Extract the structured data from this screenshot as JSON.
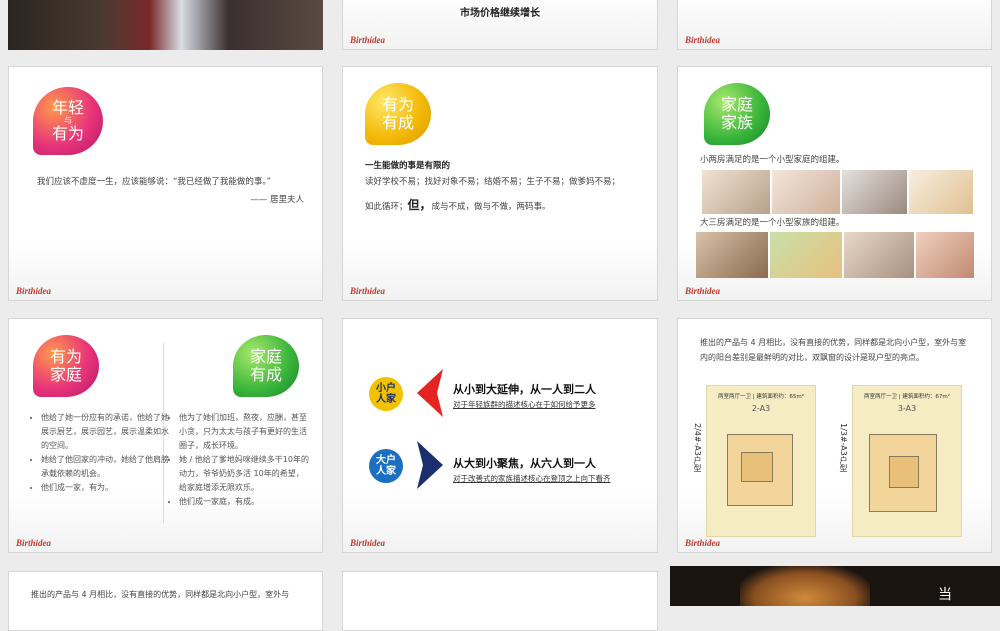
{
  "brand_mark": "Birthidea",
  "slides": {
    "top_center": {
      "heading": "市场价格继续增长"
    },
    "youth": {
      "bubble_line1": "年轻",
      "bubble_line2": "与",
      "bubble_line3": "有为",
      "quote": "我们应该不虚度一生，应该能够说：“我已经做了我能做的事。”",
      "author": "—— 居里夫人"
    },
    "achieve": {
      "bubble_line1": "有为",
      "bubble_line2": "有成",
      "title": "一生能做的事是有限的",
      "line1": "读好学校不易；找好对象不易；结婚不易；生子不易；做爹妈不易；",
      "line2_before": "如此循环；",
      "line2_emph": "但，",
      "line2_after": "成与不成，做与不做，两码事。"
    },
    "family": {
      "bubble_line1": "家庭",
      "bubble_line2": "家族",
      "caption1": "小两房满足的是一个小型家庭的组建。",
      "caption2": "大三房满足的是一个小型家族的组建。"
    },
    "home": {
      "bubble_left_line1": "有为",
      "bubble_left_line2": "家庭",
      "bubble_right_line1": "家庭",
      "bubble_right_line2": "有成",
      "left_bullets": [
        "他给了她一份应有的承诺，他给了她展示厨艺，展示园艺，展示温柔如水的空间。",
        "她给了他回家的冲动，她给了他肩膀承载依赖的机会。",
        "他们成一家，有为。"
      ],
      "right_bullets": [
        "他为了她们加班，熬夜，应酬，甚至小贪，只为太太与孩子有更好的生活圈子，成长环境。",
        "她 / 他给了爹地妈咪继续多干10年的动力，爷爷奶奶多活 10年的希望，给家庭增添无限欢乐。",
        "他们成一家庭，有成。"
      ]
    },
    "units": {
      "small_badge_line1": "小户",
      "small_badge_line2": "人家",
      "small_title": "从小到大延伸，从一人到二人",
      "small_sub": "对于年轻族群的描述核心在于如何给予更多",
      "large_badge_line1": "大户",
      "large_badge_line2": "人家",
      "large_title": "从大到小聚焦，从六人到一人",
      "large_sub": "对于改善式的家族描述核心在登顶之上向下看齐"
    },
    "plans": {
      "intro": "推出的产品与 4 月相比，没有直接的优势，同样都是北向小户型，室外与室内的阳台差别是最鲜明的对比，双飘窗的设计是现户型的亮点。",
      "plan1_header": "两室两厅一卫 | 建筑面积约：65m²",
      "plan1_code": "2-A3",
      "plan1_side": "2/4#-A3户型",
      "plan2_header": "两室两厅一卫 | 建筑面积约：67m²",
      "plan2_code": "3-A3",
      "plan2_side": "1/3#-A3户型"
    },
    "bottom_left": {
      "intro": "推出的产品与 4 月相比，没有直接的优势，同样都是北向小户型，室外与"
    },
    "bottom_right": {
      "side_char": "当"
    }
  },
  "colors": {
    "red_arrow": "#e52421",
    "navy_arrow": "#1b2f6e",
    "brand": "#c0392b"
  }
}
